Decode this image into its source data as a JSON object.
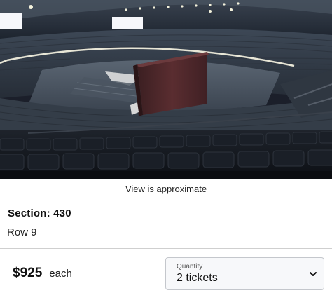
{
  "view": {
    "caption": "View is approximate"
  },
  "seat": {
    "section": "Section: 430",
    "row": "Row 9"
  },
  "pricing": {
    "price": "$925",
    "unit": "each"
  },
  "quantity": {
    "label": "Quantity",
    "selected": "2 tickets"
  }
}
